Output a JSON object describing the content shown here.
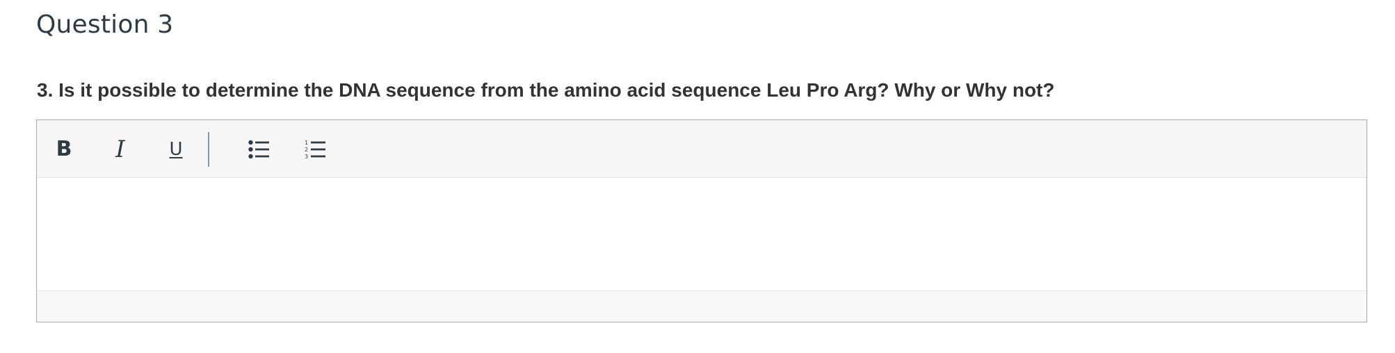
{
  "question": {
    "title": "Question 3",
    "text": "3. Is it possible to determine the DNA sequence from the amino acid sequence Leu Pro Arg? Why or Why not?"
  },
  "editor": {
    "toolbar": {
      "bold_label": "B",
      "italic_label": "I",
      "underline_label": "U",
      "bullet_list_icon": "bullet-list-icon",
      "numbered_list_icon": "numbered-list-icon"
    },
    "content": ""
  },
  "colors": {
    "text": "#2d3b45",
    "toolbar_background": "#f7f7f7",
    "border": "#a8a8a8"
  }
}
